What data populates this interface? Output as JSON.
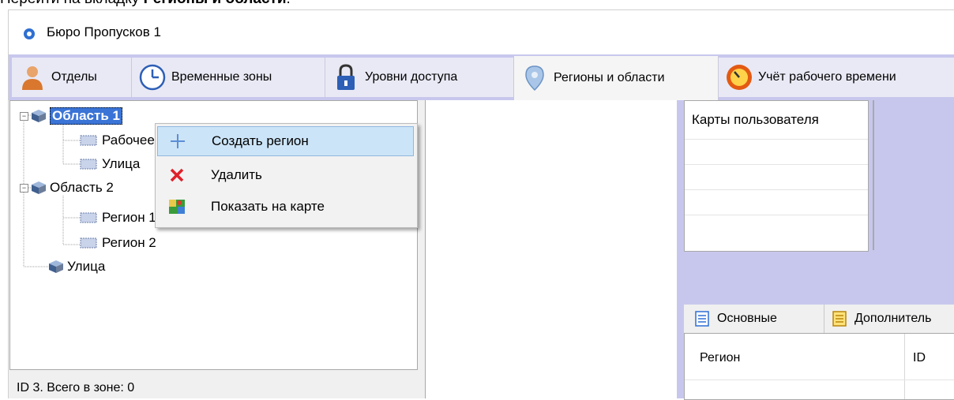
{
  "doc": {
    "prefix": "Перейти на вкладку ",
    "bold": "Регионы и области",
    "suffix": "."
  },
  "window": {
    "title": "Бюро Пропусков 1"
  },
  "tabs": [
    {
      "label": "Отделы",
      "icon": "person-icon"
    },
    {
      "label": "Временные зоны",
      "icon": "clock-icon"
    },
    {
      "label": "Уровни доступа",
      "icon": "padlock-icon"
    },
    {
      "label": "Регионы и области",
      "icon": "map-pin-icon",
      "active": true
    },
    {
      "label": "Учёт рабочего времени",
      "icon": "stopwatch-icon"
    }
  ],
  "tree": {
    "nodes": [
      {
        "label": "Область 1",
        "selected": true,
        "type": "area"
      },
      {
        "label": "Рабочее место",
        "type": "region"
      },
      {
        "label": "Улица",
        "type": "region"
      },
      {
        "label": "Область 2",
        "type": "area"
      },
      {
        "label": "Регион 1",
        "type": "region"
      },
      {
        "label": "Регион 2",
        "type": "region"
      },
      {
        "label": "Улица",
        "type": "area"
      }
    ]
  },
  "context_menu": {
    "items": [
      {
        "label": "Создать регион",
        "icon": "plus-icon",
        "highlighted": true
      },
      {
        "label": "Удалить",
        "icon": "delete-x-icon"
      },
      {
        "label": "Показать на карте",
        "icon": "map-icon"
      }
    ]
  },
  "status": {
    "text": "ID 3. Всего в зоне: 0"
  },
  "maps_panel": {
    "header": "Карты пользователя"
  },
  "subtabs": [
    {
      "label": "Основные",
      "icon": "list-icon"
    },
    {
      "label": "Дополнитель",
      "icon": "list-yellow-icon"
    }
  ],
  "grid": {
    "columns": [
      "Регион",
      "ID"
    ]
  },
  "colors": {
    "tabstrip": "#c7c7ee",
    "selection": "#3a74d6",
    "menu_highlight": "#cce4f7"
  }
}
